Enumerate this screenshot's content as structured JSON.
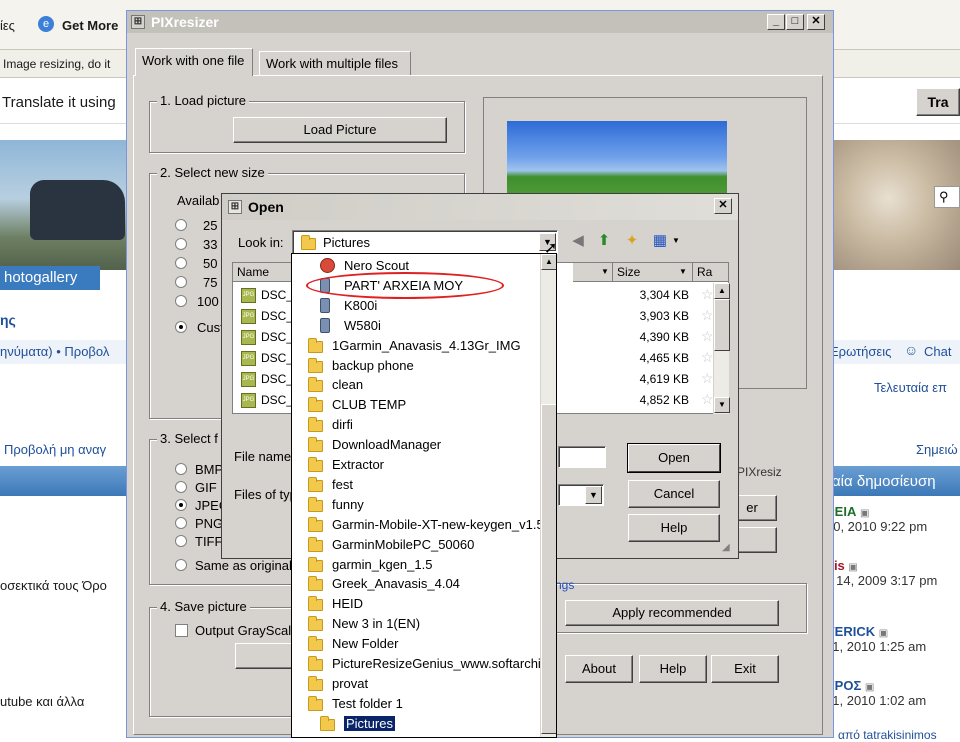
{
  "browser": {
    "menu_left": "ίες",
    "get_more": "Get More",
    "tab_title": "Image resizing, do it",
    "translate": "Translate it using",
    "translate_btn": "Tra",
    "photogallery": "hotogallery",
    "section": "ης",
    "nav_left": "ηνύματα) • Προβολ",
    "nav_right": "Ερωτήσεις",
    "chat": "Chat",
    "last_posts": "Τελευταία επ",
    "view_unread": "Προβολή μη αναγ",
    "notes": "Σημειώ",
    "latest_post": "αία δημοσίευση",
    "terms": "οσεκτικά τους Όρο",
    "youtube": "utube και άλλα",
    "forum_rows": [
      {
        "title": "ΡΕΙΑ",
        "date": "10, 2010 9:22 pm"
      },
      {
        "title": "nis",
        "date": "y 14, 2009 3:17 pm"
      },
      {
        "title": "VERICK",
        "date": "11, 2010 1:25 am"
      },
      {
        "title": "ΥΡΟΣ",
        "date": "11, 2010 1:02 am"
      }
    ],
    "bottom_link": "από tatrakisinimos"
  },
  "pix": {
    "title": "PIXresizer",
    "tabs": [
      "Work with one file",
      "Work with multiple files"
    ],
    "load_group": "1. Load picture",
    "load_btn": "Load Picture",
    "size_group": "2. Select new size",
    "available": "Availab",
    "size_options": [
      "25",
      "33",
      "50",
      "75",
      "100",
      "Cust"
    ],
    "format_group": "3. Select f",
    "formats": [
      "BMP",
      "GIF",
      "JPEG",
      "PNG",
      "TIFF"
    ],
    "same_as_original": "Same as original",
    "save_group": "4. Save picture",
    "grayscale": "Output GrayScale",
    "settings_link": "ngs",
    "apply_btn": "Apply recommended",
    "about_btn": "About",
    "help_btn": "Help",
    "exit_btn": "Exit",
    "pix_label": "PIXresiz",
    "side_btn": "er"
  },
  "open_dialog": {
    "title": "Open",
    "look_in_label": "Look in:",
    "look_in_value": "Pictures",
    "columns": {
      "name": "Name",
      "size": "Size",
      "rating": "Ra"
    },
    "files": [
      {
        "name": "DSC_",
        "size": "3,304 KB"
      },
      {
        "name": "DSC_",
        "size": "3,903 KB"
      },
      {
        "name": "DSC_",
        "size": "4,390 KB"
      },
      {
        "name": "DSC_",
        "size": "4,465 KB"
      },
      {
        "name": "DSC_",
        "size": "4,619 KB"
      },
      {
        "name": "DSC_",
        "size": "4,852 KB"
      }
    ],
    "file_name_label": "File name",
    "file_type_label": "Files of typ",
    "open_btn": "Open",
    "cancel_btn": "Cancel",
    "help_btn": "Help"
  },
  "dropdown": {
    "items": [
      {
        "label": "Nero Scout",
        "icon": "nero-icon",
        "indent": 1
      },
      {
        "label": "PART' ARXEIA MOY",
        "icon": "phone-icon",
        "indent": 1
      },
      {
        "label": "K800i",
        "icon": "phone-icon",
        "indent": 1
      },
      {
        "label": "W580i",
        "icon": "phone-icon",
        "indent": 1
      },
      {
        "label": "1Garmin_Anavasis_4.13Gr_IMG",
        "icon": "folder-icon",
        "indent": 0
      },
      {
        "label": "backup phone",
        "icon": "folder-icon",
        "indent": 0
      },
      {
        "label": "clean",
        "icon": "folder-icon",
        "indent": 0
      },
      {
        "label": "CLUB TEMP",
        "icon": "folder-icon",
        "indent": 0
      },
      {
        "label": "dirfi",
        "icon": "folder-icon",
        "indent": 0
      },
      {
        "label": "DownloadManager",
        "icon": "folder-icon",
        "indent": 0
      },
      {
        "label": "Extractor",
        "icon": "folder-icon",
        "indent": 0
      },
      {
        "label": "fest",
        "icon": "folder-icon",
        "indent": 0
      },
      {
        "label": "funny",
        "icon": "folder-icon",
        "indent": 0
      },
      {
        "label": "Garmin-Mobile-XT-new-keygen_v1.5",
        "icon": "folder-icon",
        "indent": 0
      },
      {
        "label": "GarminMobilePC_50060",
        "icon": "folder-icon",
        "indent": 0
      },
      {
        "label": "garmin_kgen_1.5",
        "icon": "folder-icon",
        "indent": 0
      },
      {
        "label": "Greek_Anavasis_4.04",
        "icon": "folder-icon",
        "indent": 0
      },
      {
        "label": "HEID",
        "icon": "folder-icon",
        "indent": 0
      },
      {
        "label": "New 3 in 1(EN)",
        "icon": "folder-icon",
        "indent": 0
      },
      {
        "label": "New Folder",
        "icon": "folder-icon",
        "indent": 0
      },
      {
        "label": "PictureResizeGenius_www.softarchi",
        "icon": "folder-icon",
        "indent": 0
      },
      {
        "label": "provat",
        "icon": "folder-icon",
        "indent": 0
      },
      {
        "label": "Test folder 1",
        "icon": "folder-icon",
        "indent": 0
      },
      {
        "label": "Pictures",
        "icon": "folder-icon",
        "indent": 1,
        "selected": true
      }
    ]
  },
  "colors": {
    "selection": "#0a246a",
    "annotation": "#e02020",
    "title_bar": "#c3c1ba"
  }
}
